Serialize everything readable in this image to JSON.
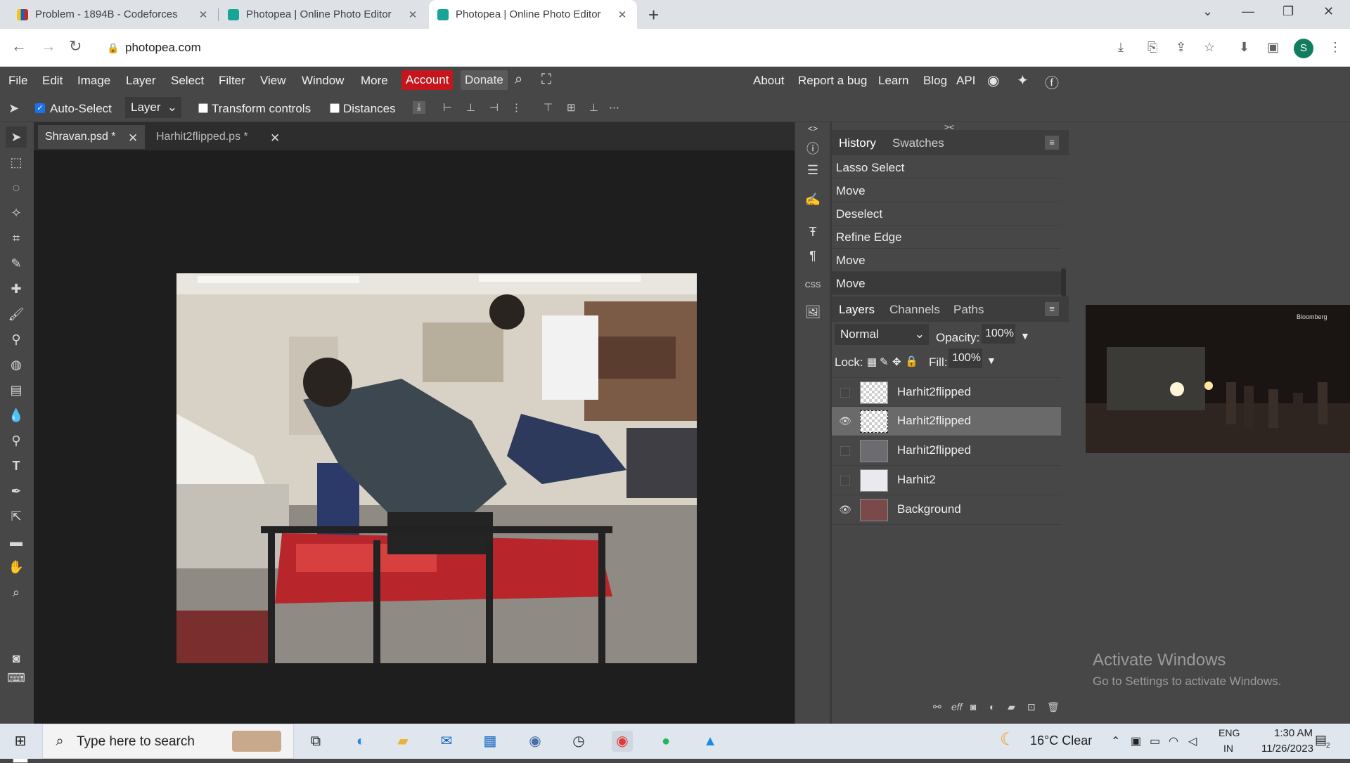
{
  "browser": {
    "tabs": [
      {
        "title": "Problem - 1894B - Codeforces",
        "favicon_color": "#3b5998"
      },
      {
        "title": "Photopea | Online Photo Editor",
        "favicon_color": "#18a497"
      },
      {
        "title": "Photopea | Online Photo Editor",
        "favicon_color": "#18a497"
      }
    ],
    "url": "photopea.com",
    "profile_initial": "S"
  },
  "menu": {
    "items": [
      "File",
      "Edit",
      "Image",
      "Layer",
      "Select",
      "Filter",
      "View",
      "Window",
      "More"
    ],
    "account": "Account",
    "donate": "Donate",
    "right_links": [
      "About",
      "Report a bug",
      "Learn",
      "Blog",
      "API"
    ]
  },
  "options": {
    "auto_select_label": "Auto-Select",
    "auto_select_checked": true,
    "layer_select_value": "Layer",
    "transform_controls_label": "Transform controls",
    "distances_label": "Distances"
  },
  "documents": {
    "tabs": [
      {
        "title": "Shravan.psd *"
      },
      {
        "title": "Harhit2flipped.ps *"
      }
    ]
  },
  "history": {
    "tabs": [
      "History",
      "Swatches"
    ],
    "items": [
      "Lasso Select",
      "Move",
      "Deselect",
      "Refine Edge",
      "Move",
      "Move"
    ]
  },
  "layers_panel": {
    "tabs": [
      "Layers",
      "Channels",
      "Paths"
    ],
    "blend_mode": "Normal",
    "opacity_label": "Opacity:",
    "opacity_value": "100%",
    "lock_label": "Lock:",
    "fill_label": "Fill:",
    "fill_value": "100%",
    "layers": [
      {
        "name": "Harhit2flipped",
        "visible": false,
        "selected": false
      },
      {
        "name": "Harhit2flipped",
        "visible": true,
        "selected": true
      },
      {
        "name": "Harhit2flipped",
        "visible": false,
        "selected": false
      },
      {
        "name": "Harhit2",
        "visible": false,
        "selected": false
      },
      {
        "name": "Background",
        "visible": true,
        "selected": false
      }
    ],
    "bottom_labels": [
      "eff"
    ]
  },
  "video_overlay": {
    "label": "Bloomberg"
  },
  "watermark": {
    "title": "Activate Windows",
    "subtitle": "Go to Settings to activate Windows."
  },
  "taskbar": {
    "search_placeholder": "Type here to search",
    "weather": "16°C  Clear",
    "language_line1": "ENG",
    "language_line2": "IN",
    "time": "1:30 AM",
    "date": "11/26/2023",
    "notification_count": "2"
  },
  "colors": {
    "accent_account": "#c4161c",
    "panel_bg": "#474747",
    "canvas_bg": "#1e1e1e"
  }
}
